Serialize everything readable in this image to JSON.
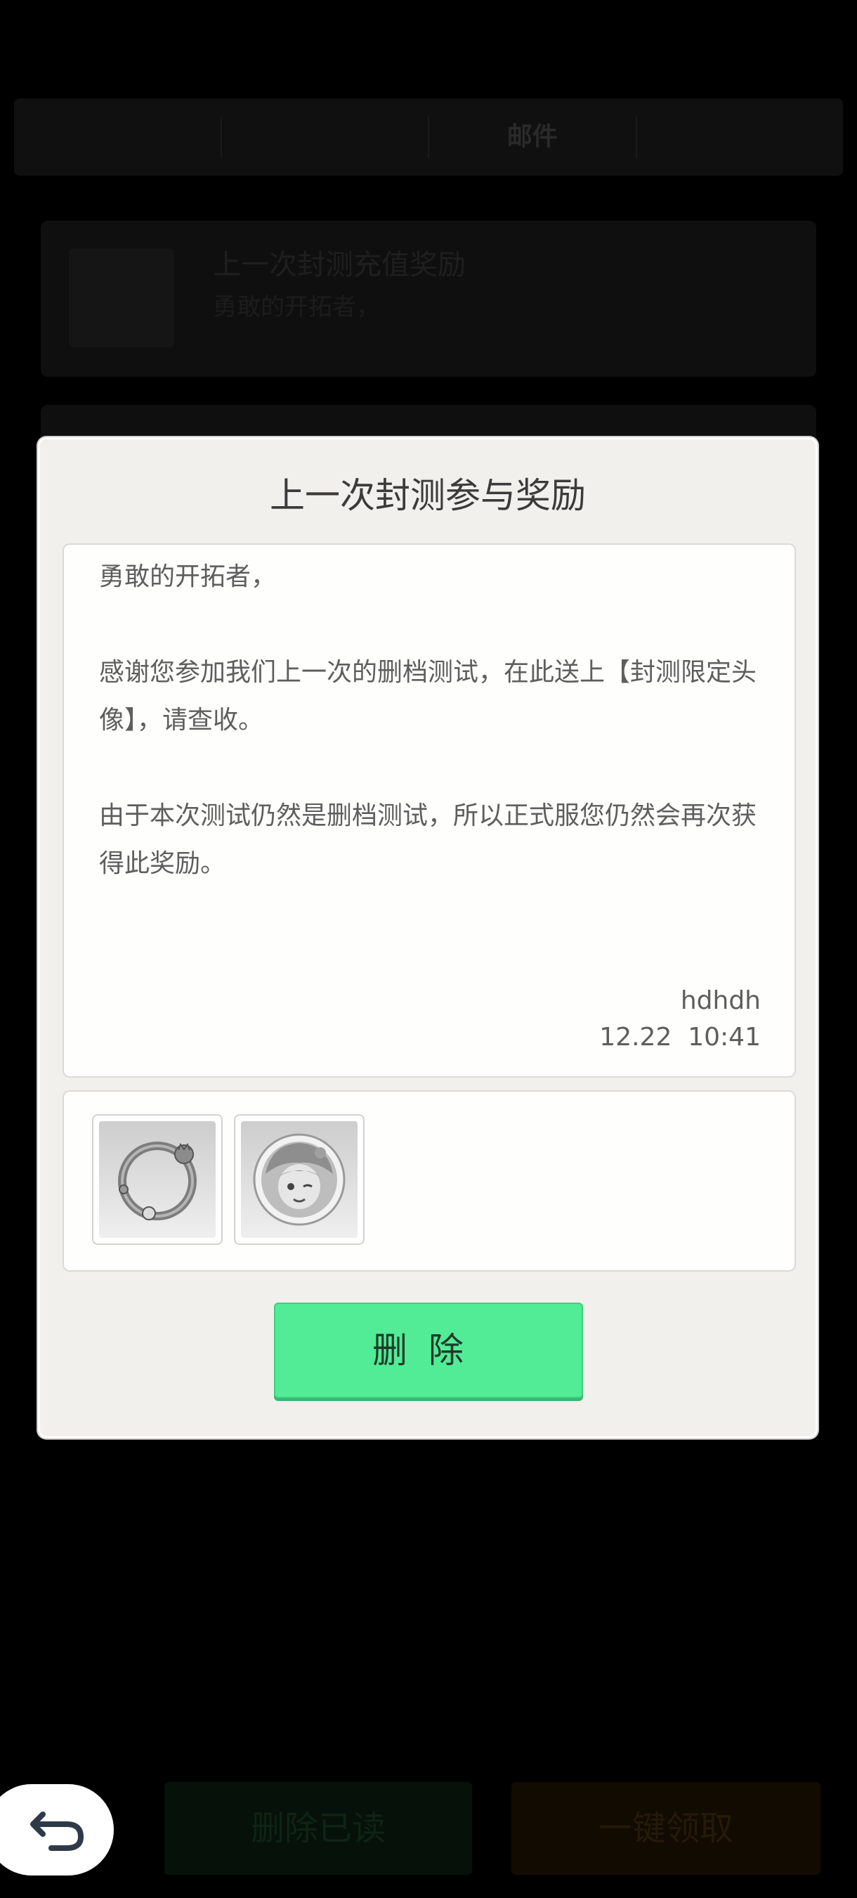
{
  "background": {
    "tabs": [
      {
        "label": "",
        "active": false
      },
      {
        "label": "",
        "active": false
      },
      {
        "label": "邮件",
        "active": true
      },
      {
        "label": "",
        "active": false
      }
    ],
    "mail_items": [
      {
        "title": "上一次封测充值奖励",
        "subtitle": "勇敢的开拓者，",
        "remaining": ""
      },
      {
        "title": "",
        "subtitle": "",
        "remaining": ""
      }
    ],
    "footer": {
      "delete_read_label": "删除已读",
      "claim_all_label": "一键领取"
    },
    "back_icon": "undo-arrow-icon"
  },
  "dialog": {
    "title": "上一次封测参与奖励",
    "greeting": "勇敢的开拓者，",
    "paragraph_1": "感谢您参加我们上一次的删档测试，在此送上【封测限定头像】，请查收。",
    "paragraph_2": "由于本次测试仍然是删档测试，所以正式服您仍然会再次获得此奖励。",
    "sender": "hdhdh",
    "datetime": "12.22  10:41",
    "attachments": [
      {
        "icon": "avatar-frame-icon"
      },
      {
        "icon": "character-avatar-icon"
      }
    ],
    "delete_label": "删除",
    "accent_color": "#52ec96"
  }
}
